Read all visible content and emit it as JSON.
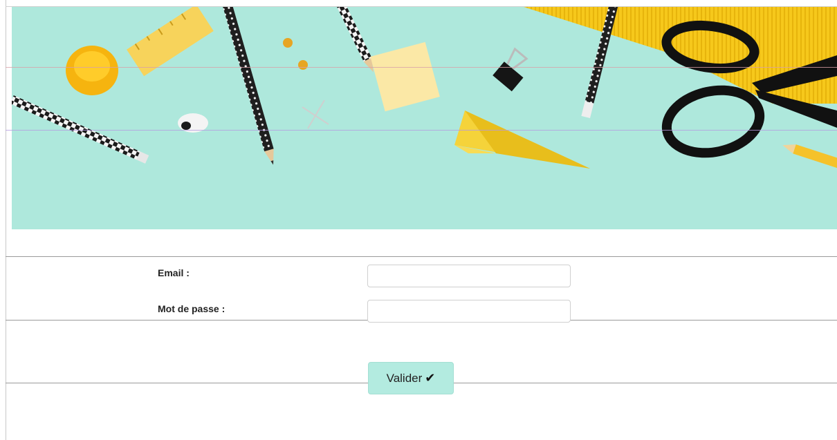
{
  "form": {
    "email_label": "Email :",
    "password_label": "Mot de passe :",
    "email_value": "",
    "password_value": "",
    "submit_label": "Valider",
    "submit_icon": "✔"
  },
  "colors": {
    "hero_background": "#aee8dc",
    "button_background": "#b3ebe0",
    "accent_yellow": "#f5c518"
  },
  "icons": [
    "check-icon"
  ]
}
